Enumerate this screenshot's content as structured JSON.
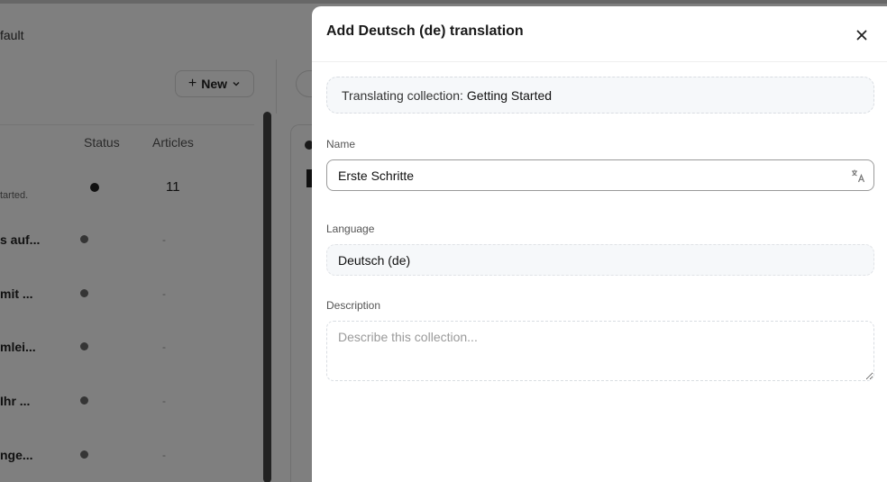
{
  "background": {
    "breadcrumb_fragment": "fault",
    "new_button_label": "New",
    "table": {
      "columns": {
        "status": "Status",
        "articles": "Articles"
      },
      "first_row_subtitle": "tarted.",
      "first_row_articles": "11",
      "rows": [
        {
          "name": "s auf...",
          "articles": "-"
        },
        {
          "name": "mit ...",
          "articles": "-"
        },
        {
          "name": "mlei...",
          "articles": "-"
        },
        {
          "name": "Ihr ...",
          "articles": "-"
        },
        {
          "name": "nge...",
          "articles": "-"
        }
      ]
    }
  },
  "drawer": {
    "title": "Add Deutsch (de) translation",
    "info": {
      "prefix": "Translating collection:",
      "collection_name": "Getting Started"
    },
    "fields": {
      "name": {
        "label": "Name",
        "value": "Erste Schritte"
      },
      "language": {
        "label": "Language",
        "value": "Deutsch (de)"
      },
      "description": {
        "label": "Description",
        "placeholder": "Describe this collection..."
      }
    }
  },
  "icons": {
    "close": "close-icon",
    "translate": "translate-icon",
    "plus": "plus-icon",
    "chevron": "chevron-down-icon"
  },
  "colors": {
    "overlay": "#000000",
    "info_bg": "#f6f8fa",
    "input_border": "#9a9a9a"
  }
}
